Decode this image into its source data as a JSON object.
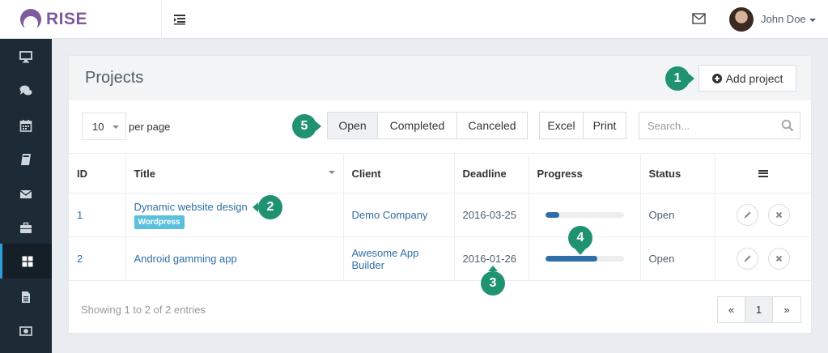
{
  "app": {
    "logo_text": "RISE",
    "brand_color": "#7c5a9c"
  },
  "topbar": {
    "user_name": "John Doe"
  },
  "sidebar": {
    "items": [
      {
        "icon": "desktop-icon"
      },
      {
        "icon": "comments-icon"
      },
      {
        "icon": "calendar-icon"
      },
      {
        "icon": "book-icon"
      },
      {
        "icon": "envelope-icon"
      },
      {
        "icon": "briefcase-icon"
      },
      {
        "icon": "th-large-icon",
        "active": true
      },
      {
        "icon": "file-icon"
      },
      {
        "icon": "money-icon"
      }
    ]
  },
  "page": {
    "title": "Projects",
    "add_label": "Add project"
  },
  "controls": {
    "per_page_value": "10",
    "per_page_label": "per page",
    "filters": [
      "Open",
      "Completed",
      "Canceled"
    ],
    "selected_filter": "Open",
    "export": [
      "Excel",
      "Print"
    ],
    "search_placeholder": "Search..."
  },
  "table": {
    "headers": {
      "id": "ID",
      "title": "Title",
      "client": "Client",
      "deadline": "Deadline",
      "progress": "Progress",
      "status": "Status"
    },
    "rows": [
      {
        "id": "1",
        "title": "Dynamic website design",
        "badge": "Wordpress",
        "client": "Demo Company",
        "deadline": "2016-03-25",
        "overdue": false,
        "progress": 0.18,
        "status": "Open"
      },
      {
        "id": "2",
        "title": "Android gamming app",
        "badge": "",
        "client": "Awesome App Builder",
        "deadline": "2016-01-26",
        "overdue": true,
        "progress": 0.67,
        "status": "Open"
      }
    ]
  },
  "footer": {
    "showing": "Showing 1 to 2 of 2 entries",
    "prev": "«",
    "page": "1",
    "next": "»"
  },
  "callouts": {
    "c1": "1",
    "c2": "2",
    "c3": "3",
    "c4": "4",
    "c5": "5",
    "color": "#1f9272"
  }
}
